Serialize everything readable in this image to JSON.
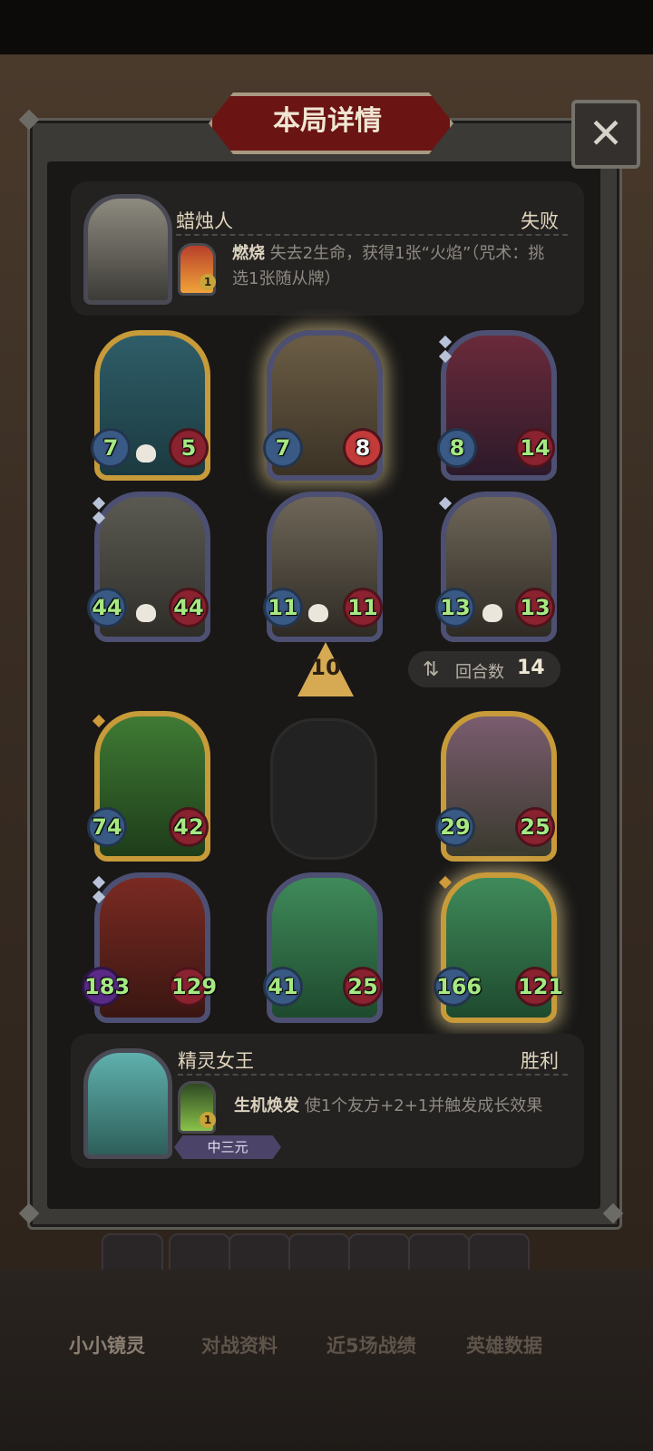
{
  "window": {
    "title": "本局详情"
  },
  "close_label": "✕",
  "opponent": {
    "name": "蜡烛人",
    "result": "失败",
    "spell_name": "燃烧",
    "spell_desc": "失去2生命，获得1张“火焰”（咒术：挑选1张随从牌）",
    "spell_level": "1"
  },
  "player": {
    "name": "精灵女王",
    "result": "胜利",
    "spell_name": "生机焕发",
    "spell_desc": "使1个友方+2+1并触发成长效果",
    "spell_level": "1",
    "tag": "中三元"
  },
  "tier": "10",
  "turns": {
    "label": "回合数",
    "value": "14",
    "icon": "swap-arrows-icon"
  },
  "opponent_board": [
    {
      "atk": "7",
      "hp": "5"
    },
    {
      "atk": "7",
      "hp": "8"
    },
    {
      "atk": "8",
      "hp": "14"
    },
    {
      "atk": "44",
      "hp": "44"
    },
    {
      "atk": "11",
      "hp": "11"
    },
    {
      "atk": "13",
      "hp": "13"
    }
  ],
  "player_board": [
    {
      "atk": "74",
      "hp": "42"
    },
    {
      "atk": "29",
      "hp": "25"
    },
    {
      "atk": "183",
      "hp": "129"
    },
    {
      "atk": "41",
      "hp": "25"
    },
    {
      "atk": "166",
      "hp": "121"
    }
  ],
  "bottom_nav": [
    "小小镜灵",
    "对战资料",
    "近5场战绩",
    "英雄数据"
  ],
  "colors": {
    "panel": "#191817",
    "title_red": "#6b1414",
    "gold_border": "#c79a3a",
    "stat_green": "#a6e882"
  }
}
